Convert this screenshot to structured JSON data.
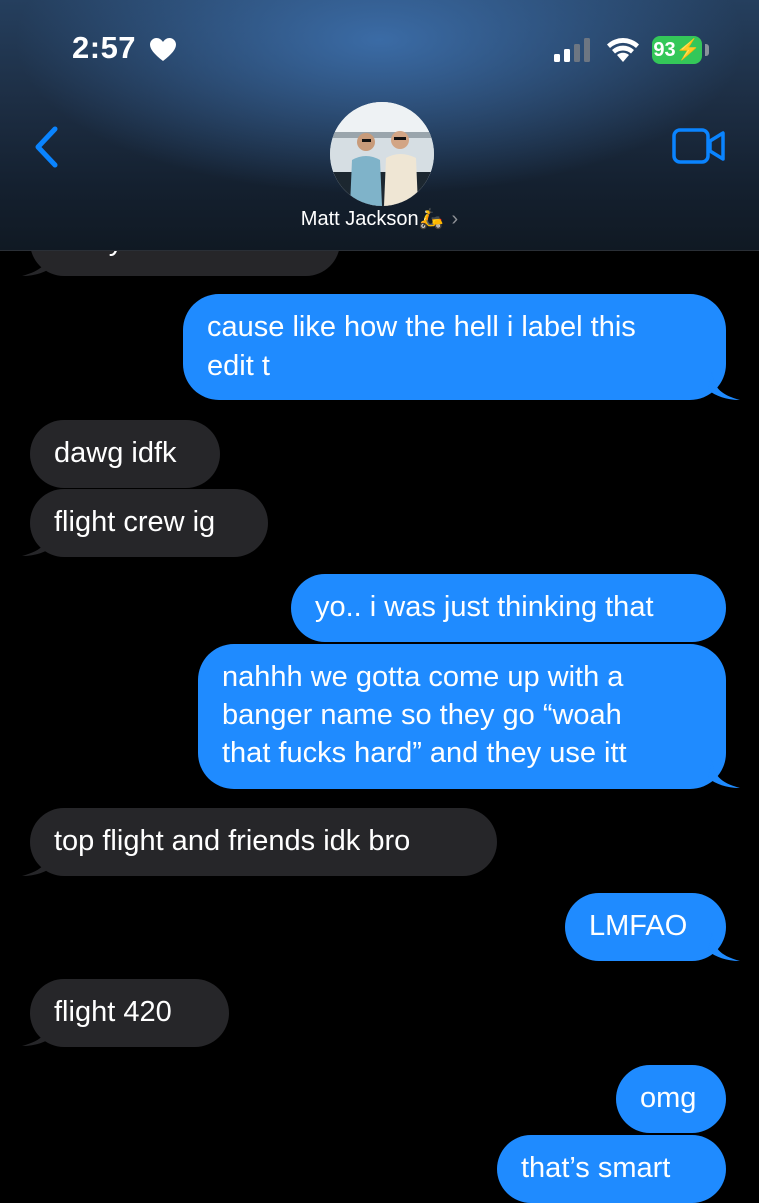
{
  "status_bar": {
    "time": "2:57",
    "battery": "93",
    "icons": [
      "heart-icon",
      "cellular-signal-icon",
      "wifi-icon",
      "battery-charging-icon"
    ]
  },
  "header": {
    "contact_name": "Matt Jackson🛵",
    "chevron": "›",
    "icons": [
      "back-chevron-icon",
      "video-call-icon",
      "contact-avatar"
    ]
  },
  "colors": {
    "sent_bubble": "#1f8bff",
    "received_bubble": "#262629",
    "background": "#000000",
    "accent": "#0a84ff"
  },
  "messages": [
    {
      "from": "them",
      "lines": [
        "i truly don’t know"
      ]
    },
    {
      "from": "me",
      "lines": [
        "cause like how the hell i label this",
        "edit t"
      ]
    },
    {
      "from": "them",
      "lines": [
        "dawg idfk"
      ]
    },
    {
      "from": "them",
      "lines": [
        "flight crew ig"
      ]
    },
    {
      "from": "me",
      "lines": [
        "yo.. i was just thinking that"
      ]
    },
    {
      "from": "me",
      "lines": [
        "nahhh we gotta come up with a",
        "banger name so they go “woah",
        "that fucks hard” and they use itt"
      ]
    },
    {
      "from": "them",
      "lines": [
        "top flight and friends idk bro"
      ]
    },
    {
      "from": "me",
      "lines": [
        "LMFAO"
      ]
    },
    {
      "from": "them",
      "lines": [
        "flight 420"
      ]
    },
    {
      "from": "me",
      "lines": [
        "omg"
      ]
    },
    {
      "from": "me",
      "lines": [
        "that’s smart"
      ]
    }
  ]
}
